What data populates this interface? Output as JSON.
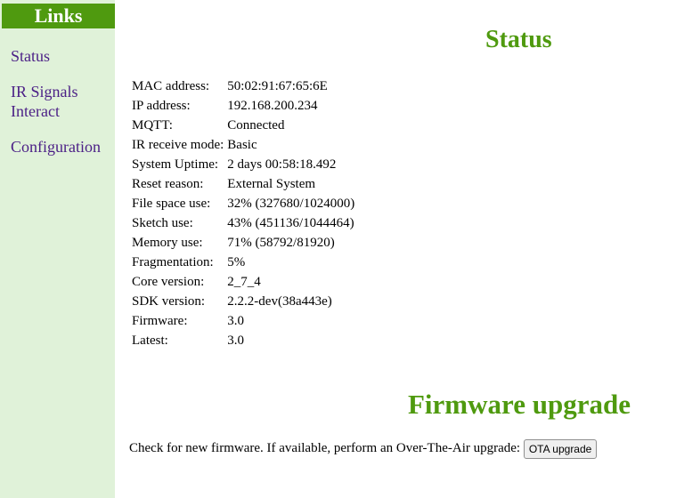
{
  "sidebar": {
    "header": "Links",
    "items": [
      {
        "label": "Status"
      },
      {
        "label": "IR Signals"
      },
      {
        "label": "Interact"
      },
      {
        "label": "Configuration"
      }
    ]
  },
  "main": {
    "title": "Status",
    "info": [
      {
        "label": "MAC address:",
        "value": "50:02:91:67:65:6E"
      },
      {
        "label": "IP address:",
        "value": "192.168.200.234"
      },
      {
        "label": "MQTT:",
        "value": "Connected"
      },
      {
        "label": "IR receive mode:",
        "value": "Basic"
      },
      {
        "label": "System Uptime:",
        "value": "2 days 00:58:18.492"
      },
      {
        "label": "Reset reason:",
        "value": "External System"
      },
      {
        "label": "File space use:",
        "value": "32% (327680/1024000)"
      },
      {
        "label": "Sketch use:",
        "value": "43% (451136/1044464)"
      },
      {
        "label": "Memory use:",
        "value": "71% (58792/81920)"
      },
      {
        "label": "Fragmentation:",
        "value": "5%"
      },
      {
        "label": "Core version:",
        "value": "2_7_4"
      },
      {
        "label": "SDK version:",
        "value": "2.2.2-dev(38a443e)"
      },
      {
        "label": "Firmware:",
        "value": "3.0"
      },
      {
        "label": "Latest:",
        "value": "3.0"
      }
    ],
    "firmware_upgrade": {
      "title": "Firmware upgrade",
      "text": "Check for new firmware. If available, perform an Over-The-Air upgrade:",
      "button_label": "OTA upgrade"
    }
  },
  "colors": {
    "accent_green": "#4f9a0f",
    "sidebar_bg": "#e0f2d9",
    "link_purple": "#4b1f86"
  }
}
